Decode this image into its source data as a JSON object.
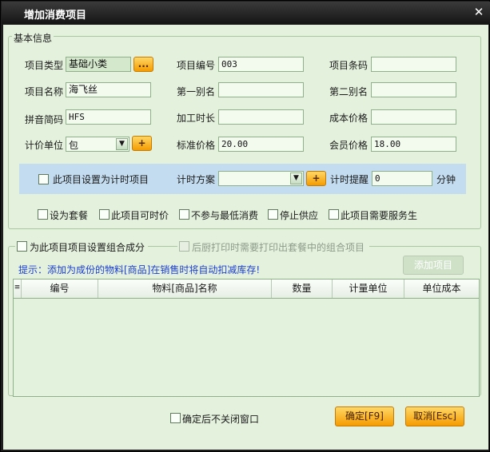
{
  "window": {
    "title": "增加消费项目",
    "close_symbol": "✕"
  },
  "basic_info": {
    "legend": "基本信息",
    "item_type": {
      "label": "项目类型",
      "value": "基础小类",
      "browse_label": "..."
    },
    "item_code": {
      "label": "项目编号",
      "value": "003"
    },
    "barcode": {
      "label": "项目条码",
      "value": ""
    },
    "item_name": {
      "label": "项目名称",
      "value": "海飞丝"
    },
    "alias1": {
      "label": "第一别名",
      "value": ""
    },
    "alias2": {
      "label": "第二别名",
      "value": ""
    },
    "pinyin": {
      "label": "拼音简码",
      "value": "HFS"
    },
    "process_time": {
      "label": "加工时长",
      "value": ""
    },
    "cost_price": {
      "label": "成本价格",
      "value": ""
    },
    "unit": {
      "label": "计价单位",
      "value": "包",
      "add_label": "+"
    },
    "std_price": {
      "label": "标准价格",
      "value": "20.00"
    },
    "member_price": {
      "label": "会员价格",
      "value": "18.00"
    }
  },
  "timing": {
    "check_label": "此项目设置为计时项目",
    "plan_label": "计时方案",
    "plan_value": "",
    "add_label": "+",
    "remind_label": "计时提醒",
    "remind_value": "0",
    "unit_label": "分钟"
  },
  "options": {
    "set_meal": "设为套餐",
    "timed_price": "此项目可时价",
    "no_min_consume": "不参与最低消费",
    "stop_supply": "停止供应",
    "need_service": "此项目需要服务生"
  },
  "combo": {
    "legend": "为此项目项目设置组合成分",
    "print_option": "后厨打印时需要打印出套餐中的组合项目",
    "hint": "提示：添加为成份的物料[商品]在销售时将自动扣减库存!",
    "add_button": "添加项目",
    "columns": [
      "编号",
      "物料[商品]名称",
      "数量",
      "计量单位",
      "单位成本"
    ]
  },
  "footer": {
    "keep_open": "确定后不关闭窗口",
    "ok_button": "确定[F9]",
    "cancel_button": "取消[Esc]"
  },
  "colors": {
    "accent": "#f59b00",
    "panel": "#e4f1dd",
    "hint": "#1c3fd0",
    "titlebar": "#1e1e1e"
  }
}
